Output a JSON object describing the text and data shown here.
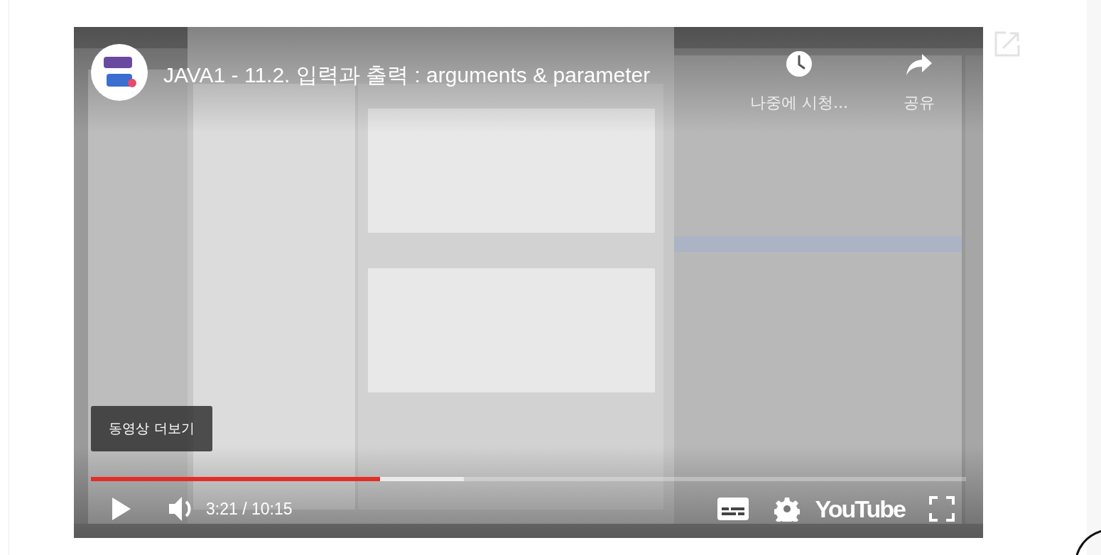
{
  "video": {
    "kind": "picture",
    "title": "JAVA1 - 11.2. 입력과 출력 : arguments & parameter",
    "watch_later": "나중에 시청...",
    "share": "공유",
    "more_videos": "동영상 더보기",
    "progress": {
      "level": 0.33
    },
    "buffer": {
      "level": 0.426
    },
    "time": "3:21 / 10:15",
    "logo": "YouTube"
  }
}
